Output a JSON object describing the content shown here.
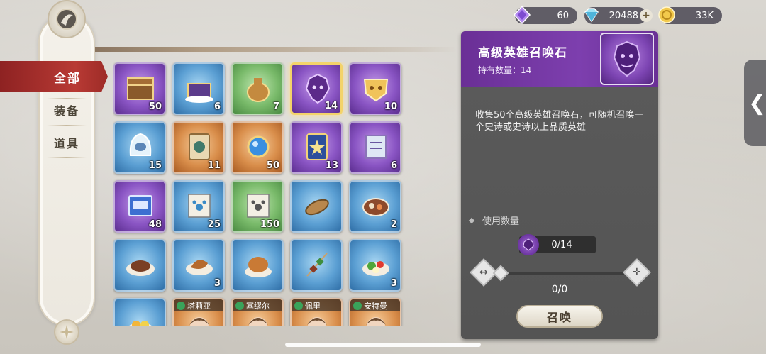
{
  "currencies": [
    {
      "icon": "purple-crystal-icon",
      "value": "60",
      "has_plus": false
    },
    {
      "icon": "blue-diamond-icon",
      "value": "20488",
      "has_plus": true
    },
    {
      "icon": "gold-coin-icon",
      "value": "33K",
      "has_plus": false
    }
  ],
  "categories": {
    "active": "全部",
    "items": [
      "装备",
      "道具"
    ]
  },
  "items": [
    {
      "icon": "treasure-chest-icon",
      "rarity": "purple",
      "count": "50"
    },
    {
      "icon": "ornate-chest-icon",
      "rarity": "blue",
      "count": "6"
    },
    {
      "icon": "money-bag-icon",
      "rarity": "green",
      "count": "7"
    },
    {
      "icon": "summon-stone-icon",
      "rarity": "purple",
      "count": "14",
      "selected": true
    },
    {
      "icon": "golden-mask-icon",
      "rarity": "purple",
      "count": "10"
    },
    {
      "icon": "hooded-spirit-icon",
      "rarity": "blue",
      "count": "15"
    },
    {
      "icon": "rune-card-icon",
      "rarity": "orange",
      "count": "11"
    },
    {
      "icon": "blue-orb-icon",
      "rarity": "orange",
      "count": "50"
    },
    {
      "icon": "star-card-icon",
      "rarity": "purple",
      "count": "13"
    },
    {
      "icon": "purple-scroll-icon",
      "rarity": "purple",
      "count": "6"
    },
    {
      "icon": "exp-book-icon",
      "rarity": "purple",
      "count": "48"
    },
    {
      "icon": "paw-scroll-icon",
      "rarity": "blue",
      "count": "25"
    },
    {
      "icon": "paw-scroll-green-icon",
      "rarity": "green",
      "count": "150"
    },
    {
      "icon": "grilled-fish-icon",
      "rarity": "blue",
      "count": ""
    },
    {
      "icon": "stew-bowl-icon",
      "rarity": "blue",
      "count": "2"
    },
    {
      "icon": "steak-plate-icon",
      "rarity": "blue",
      "count": ""
    },
    {
      "icon": "roast-meat-icon",
      "rarity": "blue",
      "count": "3"
    },
    {
      "icon": "roast-chicken-icon",
      "rarity": "blue",
      "count": ""
    },
    {
      "icon": "skewer-icon",
      "rarity": "blue",
      "count": ""
    },
    {
      "icon": "salad-icon",
      "rarity": "blue",
      "count": "3"
    },
    {
      "icon": "fruit-plate-icon",
      "rarity": "blue",
      "count": ""
    },
    {
      "icon": "hero-portrait-icon",
      "rarity": "orange",
      "count": "",
      "name": "塔莉亚"
    },
    {
      "icon": "hero-portrait-icon",
      "rarity": "orange",
      "count": "",
      "name": "塞缪尔"
    },
    {
      "icon": "hero-portrait-icon",
      "rarity": "orange",
      "count": "",
      "name": "佩里"
    },
    {
      "icon": "hero-portrait-icon",
      "rarity": "orange",
      "count": "",
      "name": "安特曼"
    }
  ],
  "detail": {
    "title": "高级英雄召唤石",
    "held": "持有数量：14",
    "description": "收集50个高级英雄召唤石，可随机召唤一个史诗或史诗以上品质英雄",
    "use_label": "使用数量",
    "use_count": "0/14",
    "slider_value": "0/0",
    "summon_label": "召唤"
  },
  "side_tab": {
    "label": "❮"
  },
  "colors": {
    "active_category": "#b83a34",
    "detail_header": "#7d3fae",
    "panel_bg": "#5b5b5b"
  }
}
